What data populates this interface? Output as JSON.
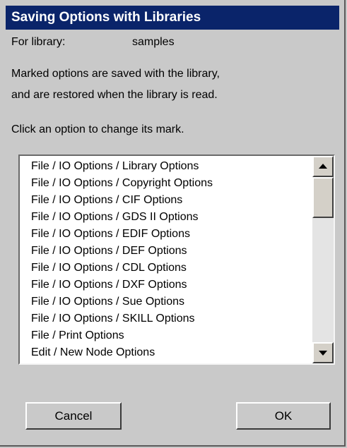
{
  "dialog": {
    "title": "Saving Options with Libraries",
    "library_label": "For library:",
    "library_name": "samples",
    "description_line1": "Marked options are saved with the library,",
    "description_line2": "and are restored when the library is read.",
    "instruction": "Click an option to change its mark."
  },
  "options_list": {
    "items": [
      "File / IO Options / Library Options",
      "File / IO Options / Copyright Options",
      "File / IO Options / CIF Options",
      "File / IO Options / GDS II Options",
      "File / IO Options / EDIF Options",
      "File / IO Options / DEF Options",
      "File / IO Options / CDL Options",
      "File / IO Options / DXF Options",
      "File / IO Options / Sue Options",
      "File / IO Options / SKILL Options",
      "File / Print Options",
      "Edit / New Node Options"
    ]
  },
  "buttons": {
    "cancel_label": "Cancel",
    "ok_label": "OK"
  },
  "icons": {
    "scroll_up": "scroll-up-arrow-icon",
    "scroll_down": "scroll-down-arrow-icon"
  },
  "colors": {
    "titlebar": "#0a246a",
    "dialog_bg": "#c9c9c9",
    "list_bg": "#ffffff"
  }
}
